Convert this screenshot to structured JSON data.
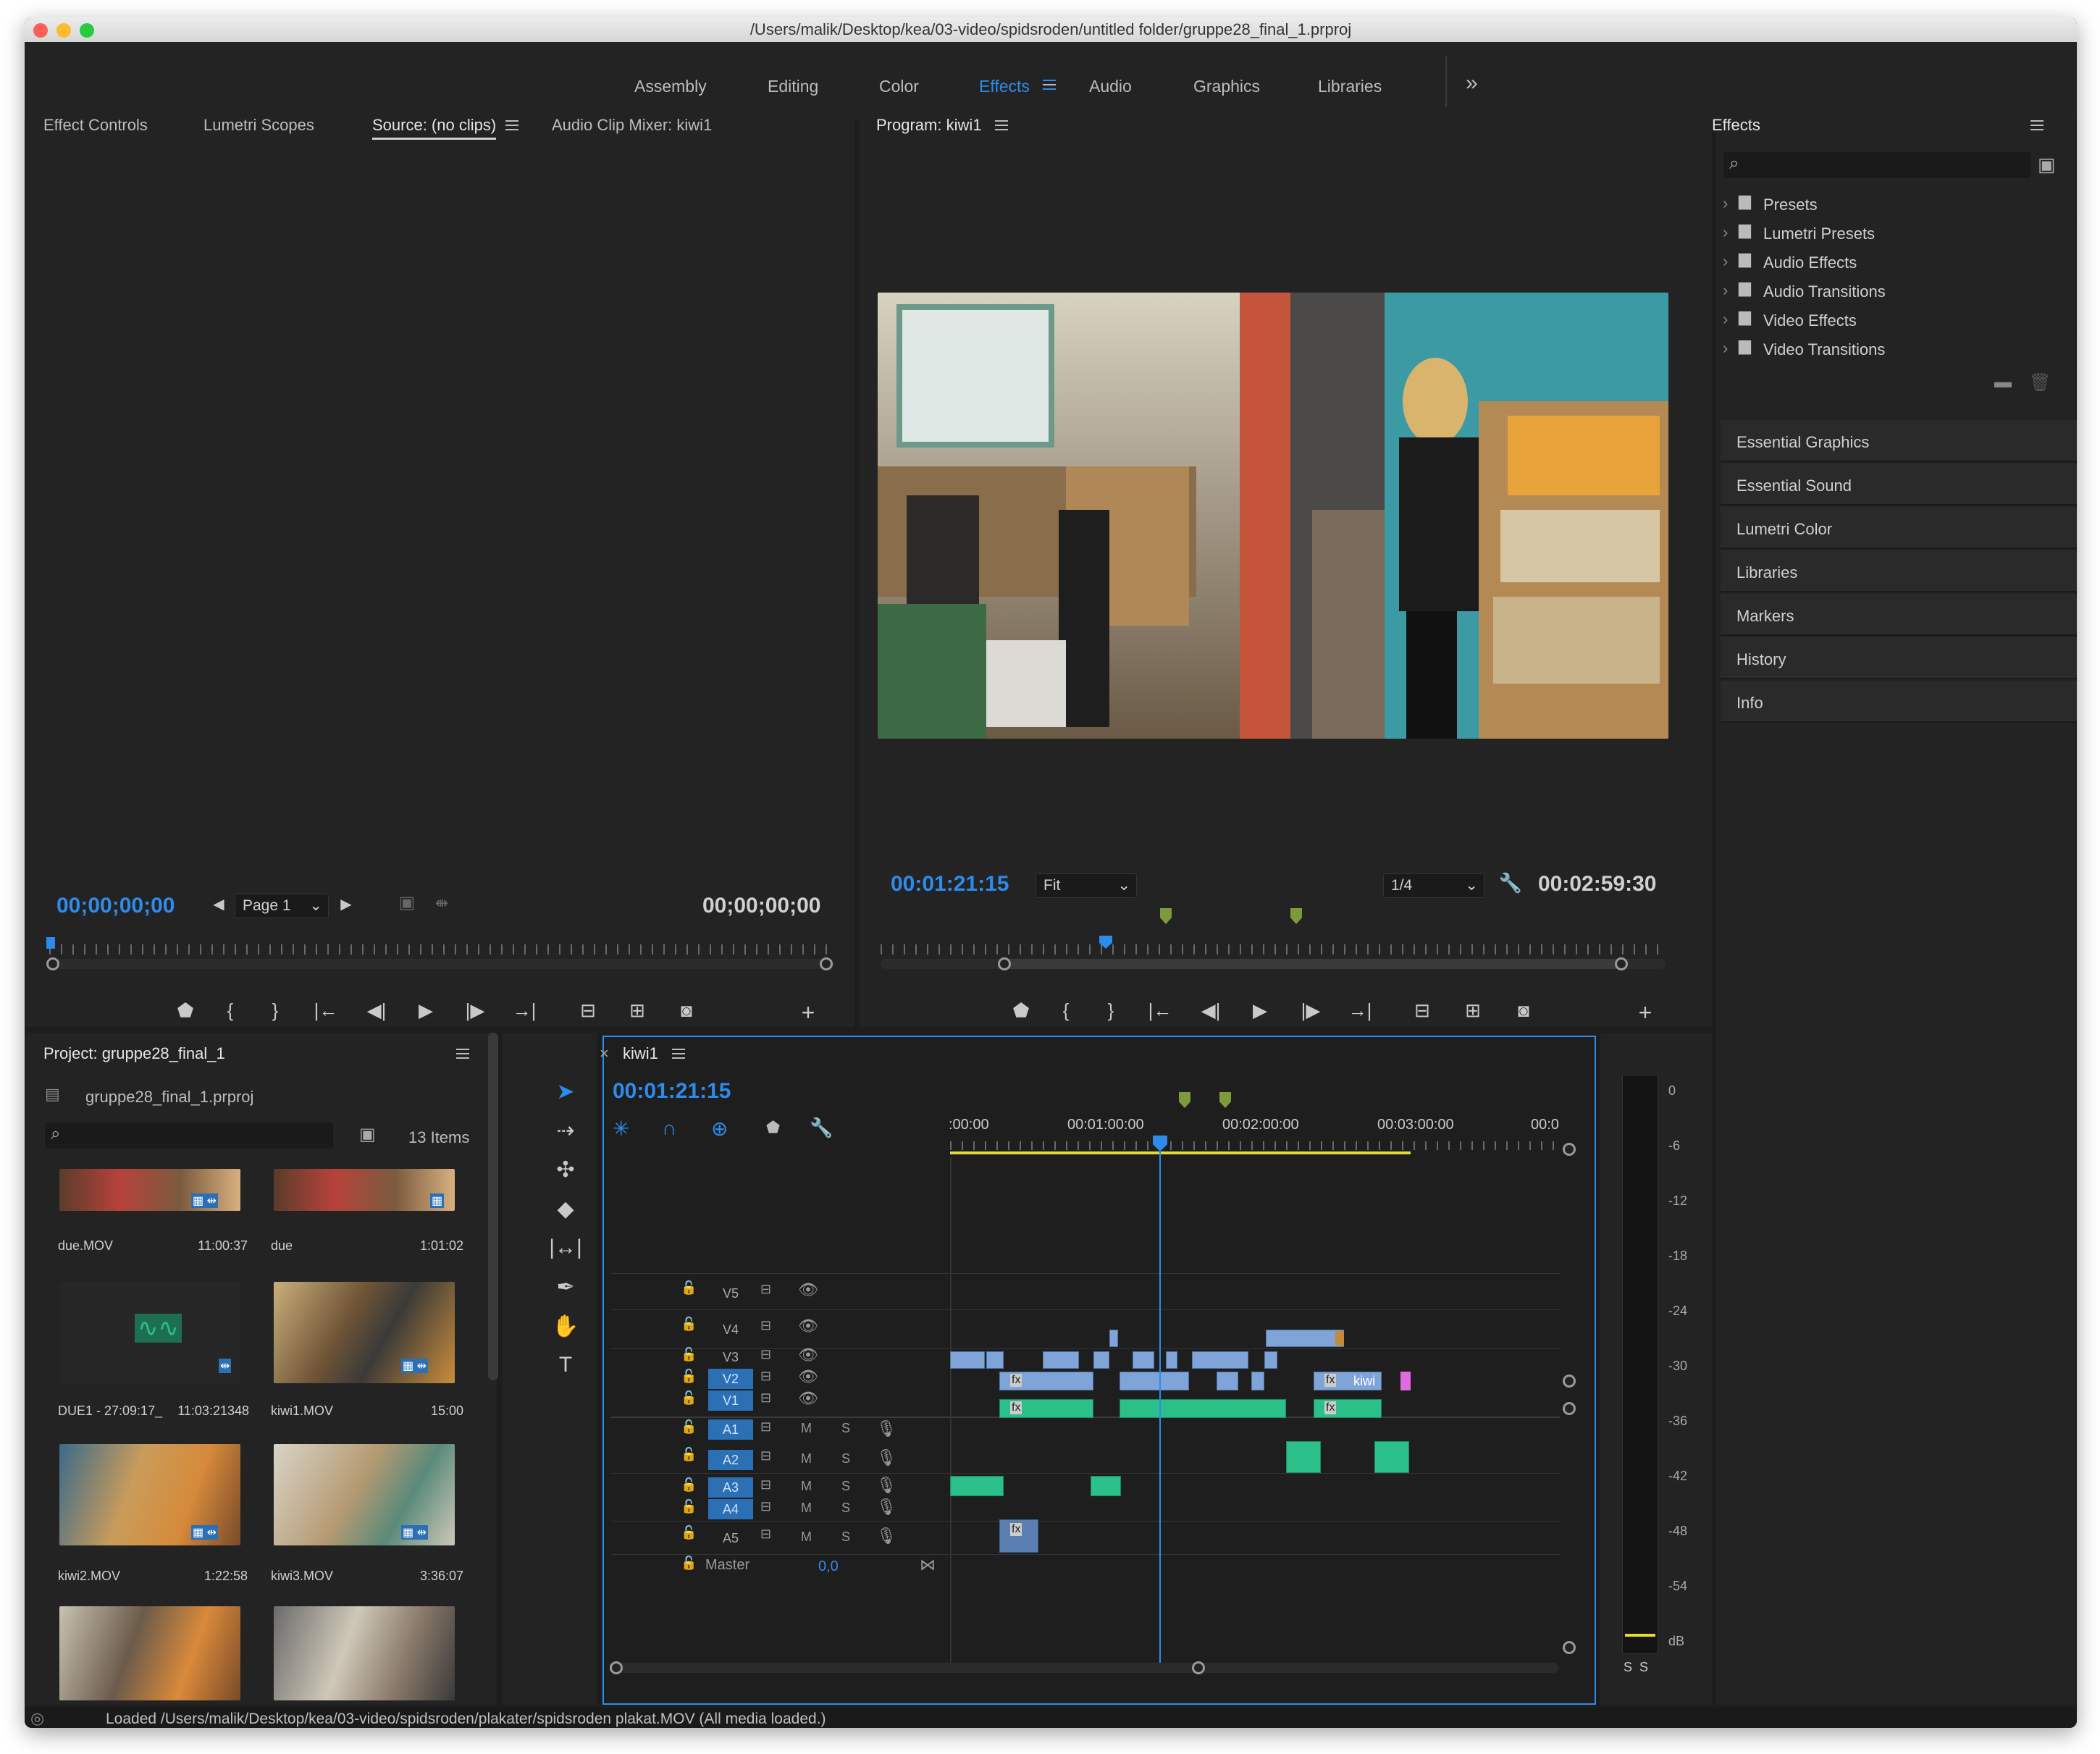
{
  "window": {
    "title": "/Users/malik/Desktop/kea/03-video/spidsroden/untitled folder/gruppe28_final_1.prproj"
  },
  "workspaces": {
    "items": [
      "Assembly",
      "Editing",
      "Color",
      "Effects",
      "Audio",
      "Graphics",
      "Libraries"
    ],
    "active": "Effects",
    "overflow": "»"
  },
  "source_panel": {
    "tabs": [
      "Effect Controls",
      "Lumetri Scopes",
      "Source: (no clips)",
      "Audio Clip Mixer: kiwi1"
    ],
    "timecode_in": "00;00;00;00",
    "timecode_out": "00;00;00;00",
    "page_select": "Page 1"
  },
  "program_panel": {
    "title": "Program: kiwi1",
    "timecode": "00:01:21:15",
    "fit": "Fit",
    "resolution": "1/4",
    "duration": "00:02:59:30"
  },
  "effects_panel": {
    "title": "Effects",
    "search_placeholder": "",
    "folders": [
      "Presets",
      "Lumetri Presets",
      "Audio Effects",
      "Audio Transitions",
      "Video Effects",
      "Video Transitions"
    ]
  },
  "side_panels": [
    "Essential Graphics",
    "Essential Sound",
    "Lumetri Color",
    "Libraries",
    "Markers",
    "History",
    "Info"
  ],
  "project_panel": {
    "title": "Project: gruppe28_final_1",
    "file": "gruppe28_final_1.prproj",
    "item_count": "13 Items",
    "items": [
      {
        "name": "due.MOV",
        "duration": "11:00:37"
      },
      {
        "name": "due",
        "duration": "1:01:02"
      },
      {
        "name": "DUE1 - 27:09:17_",
        "duration": "11:03:21348"
      },
      {
        "name": "kiwi1.MOV",
        "duration": "15:00"
      },
      {
        "name": "kiwi2.MOV",
        "duration": "1:22:58"
      },
      {
        "name": "kiwi3.MOV",
        "duration": "3:36:07"
      }
    ]
  },
  "timeline": {
    "sequence": "kiwi1",
    "timecode": "00:01:21:15",
    "ruler_labels": [
      ":00:00",
      "00:01:00:00",
      "00:02:00:00",
      "00:03:00:00",
      "00:0"
    ],
    "video_tracks": [
      "V5",
      "V4",
      "V3",
      "V2",
      "V1"
    ],
    "audio_tracks": [
      "A1",
      "A2",
      "A3",
      "A4",
      "A5"
    ],
    "track_m": "M",
    "track_s": "S",
    "master_label": "Master",
    "master_value": "0,0",
    "clip_label": "kiwi",
    "fx": "fx"
  },
  "meter": {
    "labels": [
      "0",
      "-6",
      "-12",
      "-18",
      "-24",
      "-30",
      "-36",
      "-42",
      "-48",
      "-54",
      "dB"
    ],
    "solo": "S  S"
  },
  "status": {
    "text": "Loaded /Users/malik/Desktop/kea/03-video/spidsroden/plakater/spidsroden plakat.MOV (All media loaded.)"
  },
  "colors": {
    "accent": "#2d8ceb",
    "panel": "#232323",
    "video_clip": "#7ea4d8",
    "audio_clip": "#2bbf8a"
  }
}
